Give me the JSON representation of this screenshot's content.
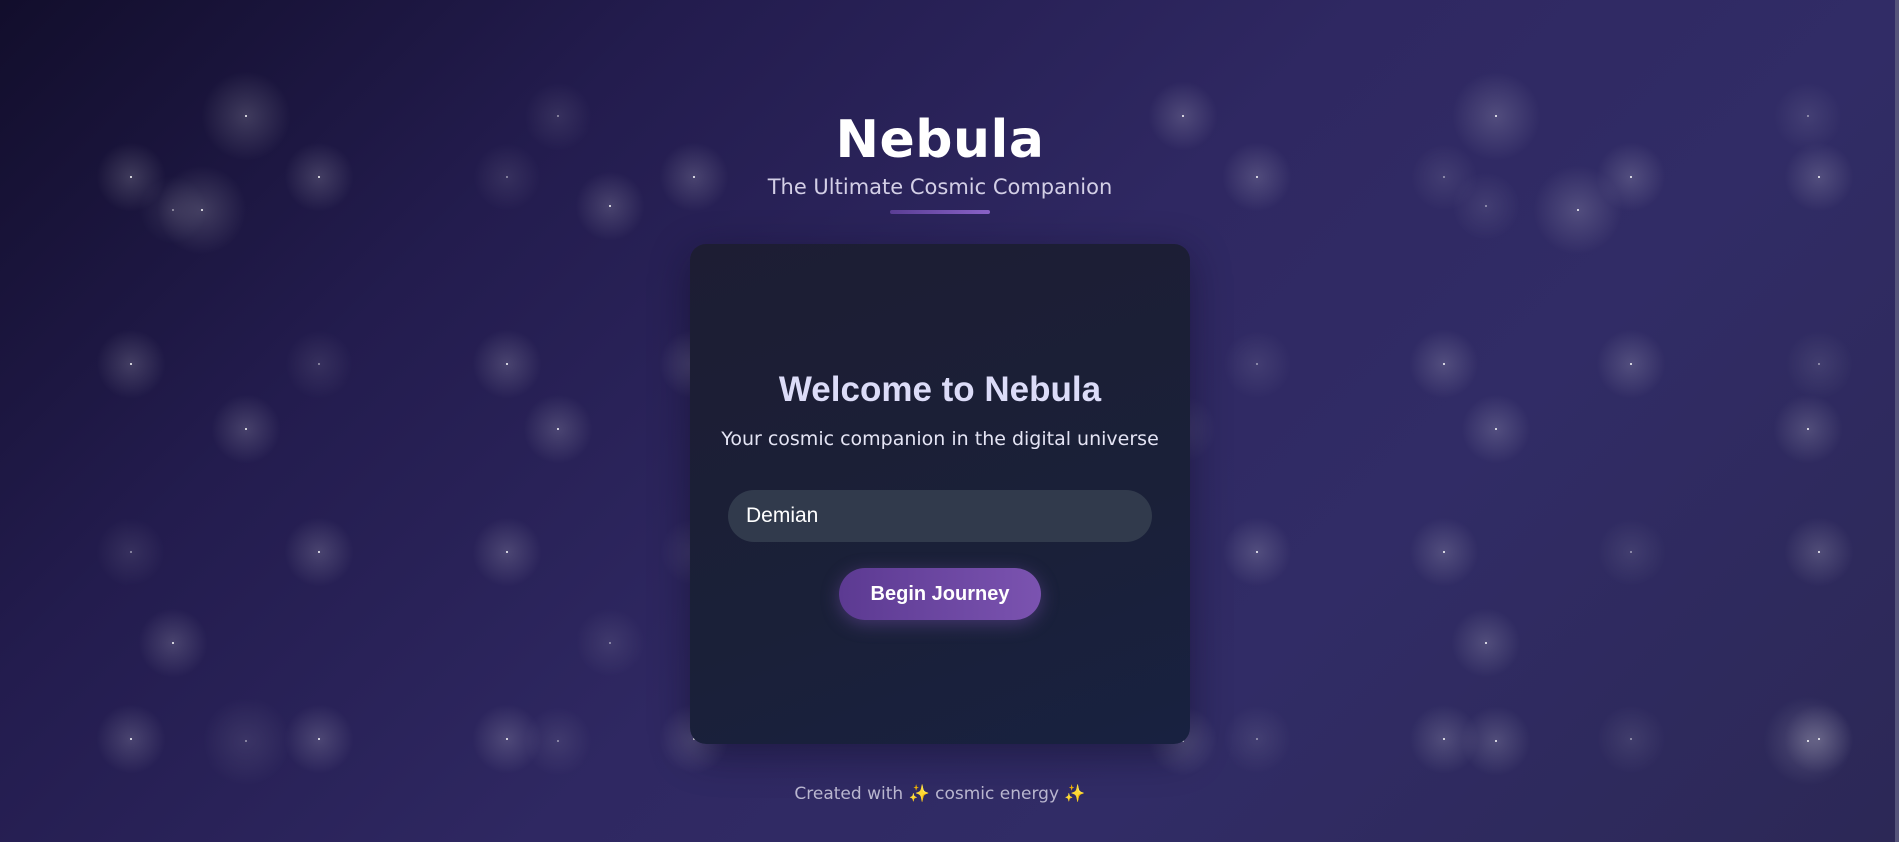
{
  "header": {
    "title": "Nebula",
    "subtitle": "The Ultimate Cosmic Companion"
  },
  "welcome_card": {
    "title": "Welcome to Nebula",
    "text": "Your cosmic companion in the digital universe",
    "name_input": {
      "value": "Demian"
    },
    "begin_button_label": "Begin Journey"
  },
  "footer": {
    "text": "Created with ✨ cosmic energy ✨"
  },
  "colors": {
    "accent": "#7b53b0",
    "card_background": "#1b1f36",
    "input_background": "#313a4c",
    "background_dark": "#120e2c",
    "background_mid": "#2f2862"
  }
}
